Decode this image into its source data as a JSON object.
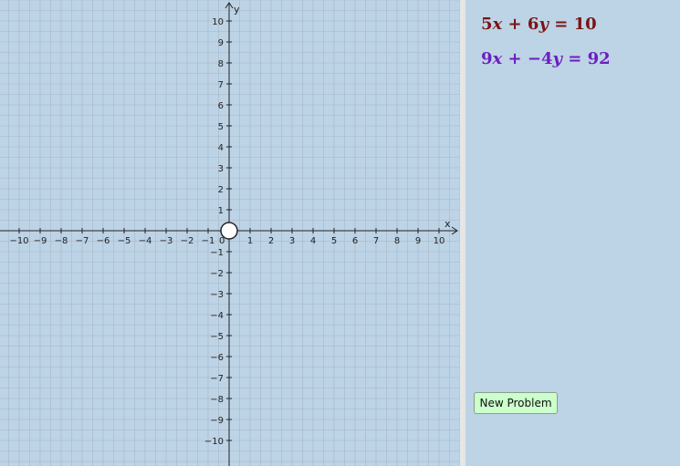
{
  "graph": {
    "x_axis_label": "x",
    "y_axis_label": "y",
    "x_range": [
      -10,
      10
    ],
    "y_range": [
      -10,
      10
    ],
    "x_tick_labels": [
      "−10",
      "−9",
      "−8",
      "−7",
      "−6",
      "−5",
      "−4",
      "−3",
      "−2",
      "−1",
      "0",
      "1",
      "2",
      "3",
      "4",
      "5",
      "6",
      "7",
      "8",
      "9",
      "10"
    ],
    "y_tick_labels_positive": [
      "1",
      "2",
      "3",
      "4",
      "5",
      "6",
      "7",
      "8",
      "9",
      "10"
    ],
    "y_tick_labels_negative": [
      "−1",
      "−2",
      "−3",
      "−4",
      "−5",
      "−6",
      "−7",
      "−8",
      "−9",
      "−10"
    ],
    "point": {
      "x": 0,
      "y": 0
    },
    "grid": true,
    "colors": {
      "background": "#bdd3e6",
      "grid": "#a8b8c6",
      "axis": "#222222",
      "point_fill": "#ffffff"
    }
  },
  "equations": {
    "eq1": {
      "a": "5",
      "var1": "x",
      "op": "+",
      "b": "6",
      "var2": "y",
      "equals": "=",
      "rhs": "10",
      "color": "#7a1414"
    },
    "eq2": {
      "a": "9",
      "var1": "x",
      "op": "+",
      "b": "−4",
      "var2": "y",
      "equals": "=",
      "rhs": "92",
      "color": "#6a1fbf"
    }
  },
  "buttons": {
    "new_problem": "New Problem"
  }
}
